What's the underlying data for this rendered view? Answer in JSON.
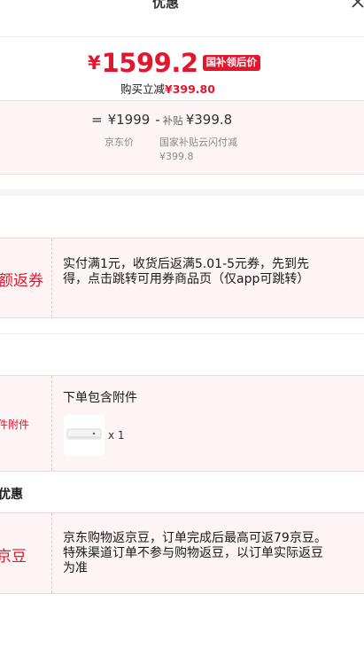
{
  "header": {
    "title": "优惠"
  },
  "price": {
    "symbol": "¥",
    "amount": "1599.2",
    "tag": "国补领后价",
    "reduce_prefix": "购买立减",
    "reduce_value": "¥399.80"
  },
  "formula": {
    "equals": "=",
    "jd_price": "¥1999",
    "minus": "-",
    "subsidy_label": "补贴",
    "subsidy_value": "¥399.8",
    "jd_label": "京东价",
    "gov_label": "国家补贴云闪付减",
    "gov_value": "¥399.8"
  },
  "rows": [
    {
      "label": "额返券",
      "text": "实付满1元，收货后返满5.01-5元券，先到先得，点击跳转可用券商品页（仅app可跳转）"
    },
    {
      "label": "件附件",
      "text": "下单包含附件",
      "qty": "x 1"
    },
    {
      "label": "京豆",
      "text": "京东购物返京豆，订单完成后最高可返79京豆。特殊渠道订单不参与购物返豆，以订单实际返豆为准"
    }
  ],
  "section": {
    "title": "优惠"
  },
  "colors": {
    "accent": "#e4162d",
    "row_bg": "#fdf5f5"
  }
}
